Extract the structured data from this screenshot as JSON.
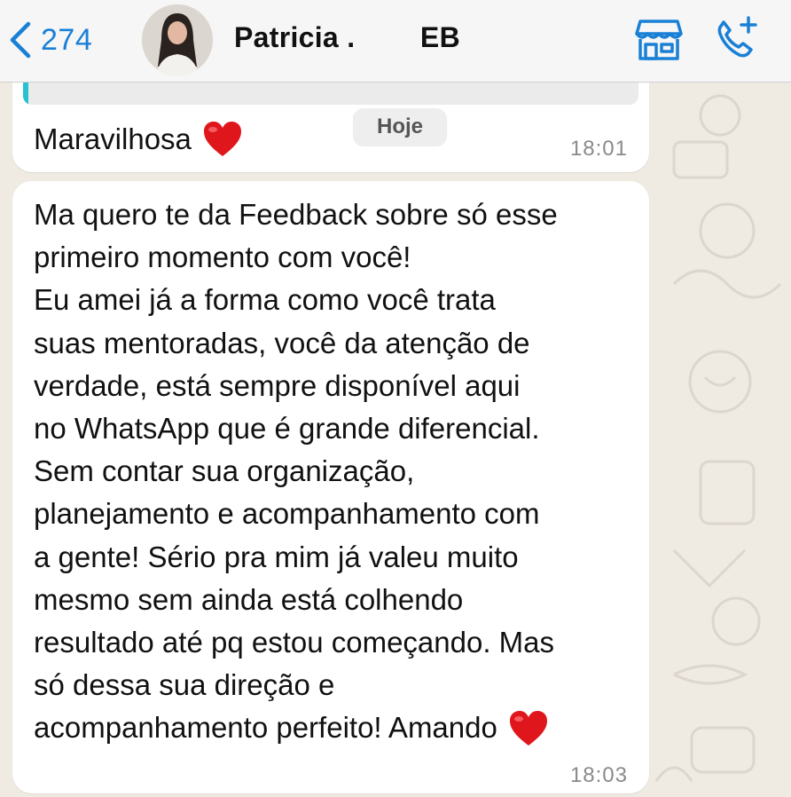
{
  "header": {
    "back_count": "274",
    "contact_name": "Patricia .        EB",
    "icons": [
      "chevron-left-icon",
      "storefront-icon",
      "phone-add-icon"
    ]
  },
  "colors": {
    "accent": "#1a80d6",
    "background": "#efeae2",
    "bubble": "#ffffff",
    "quote_bar": "#27c1d2",
    "heart": "#e0161d"
  },
  "date_divider": "Hoje",
  "messages": [
    {
      "text": "Maravilhosa",
      "emoji": "heart-icon",
      "time": "18:01"
    },
    {
      "lines": [
        "Ma quero te da Feedback sobre só esse",
        "primeiro momento com você!",
        "Eu amei já a forma como você trata",
        "suas mentoradas, você da atenção de",
        "verdade, está sempre disponível aqui",
        "no WhatsApp que é grande diferencial.",
        "Sem contar sua organização,",
        "planejamento e acompanhamento com",
        "a gente! Sério pra mim já valeu muito",
        "mesmo sem ainda está colhendo",
        "resultado até pq estou começando. Mas",
        "só dessa sua direção e",
        "acompanhamento perfeito! Amando"
      ],
      "emoji": "heart-icon",
      "time": "18:03"
    }
  ]
}
